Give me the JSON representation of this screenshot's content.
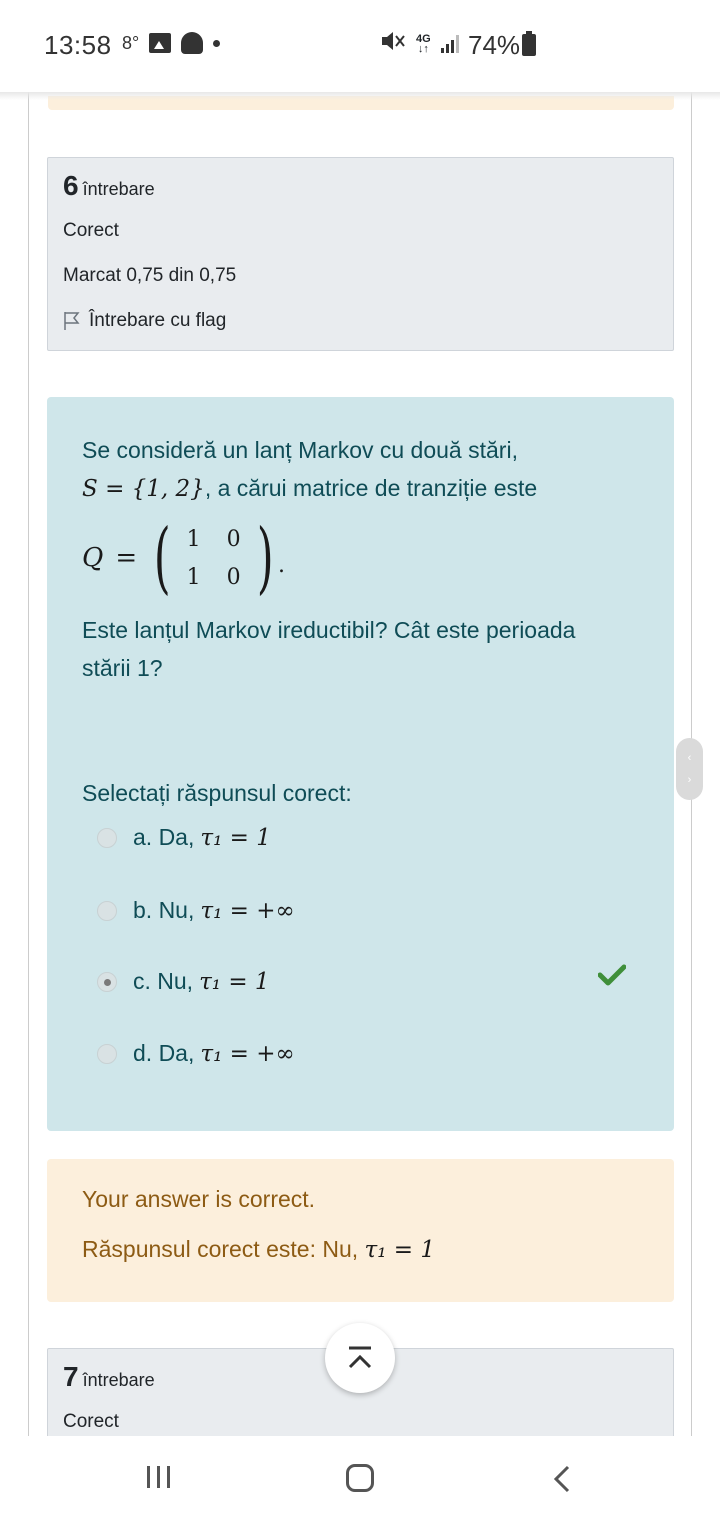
{
  "status_bar": {
    "time": "13:58",
    "small_indicator": "8°",
    "network_type": "4G",
    "battery": "74%"
  },
  "question6": {
    "number": "6",
    "word": "întrebare",
    "state": "Corect",
    "mark": "Marcat 0,75 din 0,75",
    "flag_label": "Întrebare cu flag"
  },
  "question_text": {
    "line1": "Se consideră un lanț Markov cu două stări,",
    "line2_math": "S = {1, 2}",
    "line2_text": ", a cărui matrice de tranziție este",
    "matrix_var": "Q",
    "matrix_eq": "=",
    "matrix": [
      "1",
      "0",
      "1",
      "0"
    ],
    "matrix_dot": ".",
    "question_line1": "Este lanțul Markov ireductibil?  Cât este perioada",
    "question_line2": "stării 1?"
  },
  "answer": {
    "prompt": "Selectați răspunsul corect:",
    "options": [
      {
        "label": "a. Da,",
        "math": "τ₁ = 1",
        "checked": false
      },
      {
        "label": "b. Nu,",
        "math": "τ₁ = +∞",
        "checked": false
      },
      {
        "label": "c. Nu,",
        "math": "τ₁ = 1",
        "checked": true
      },
      {
        "label": "d. Da,",
        "math": "τ₁ = +∞",
        "checked": false
      }
    ]
  },
  "feedback": {
    "result": "Your answer is correct.",
    "correct_prefix": "Răspunsul corect este: Nu,",
    "correct_math": "τ₁ = 1"
  },
  "question7": {
    "number": "7",
    "word": "întrebare",
    "state": "Corect"
  },
  "colors": {
    "question_bg": "#cfe6ea",
    "feedback_bg": "#fcefdc",
    "info_bg": "#e9ecef",
    "check_green": "#3f8f3a"
  }
}
